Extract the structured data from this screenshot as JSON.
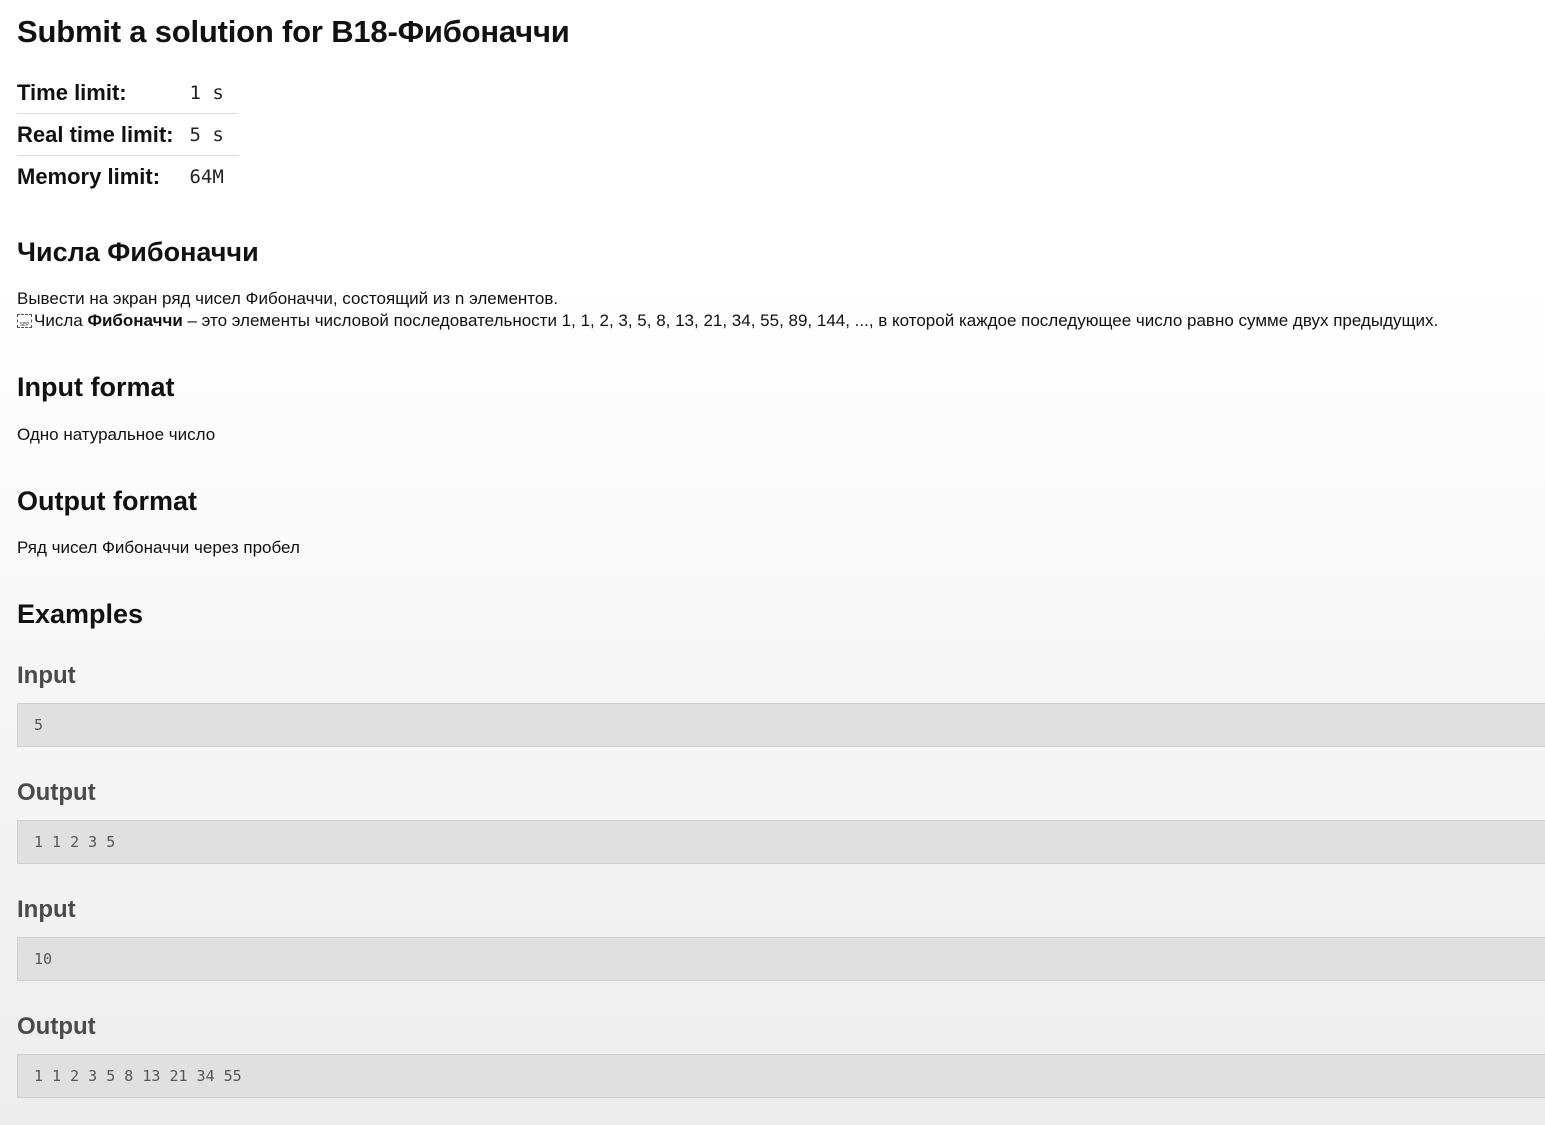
{
  "page": {
    "title": "Submit a solution for B18-Фибоначчи"
  },
  "limits": [
    {
      "label": "Time limit:",
      "value": "1 s"
    },
    {
      "label": "Real time limit:",
      "value": "5 s"
    },
    {
      "label": "Memory limit:",
      "value": "64M"
    }
  ],
  "statement": {
    "heading": "Числа Фибоначчи",
    "line1": "Вывести на экран ряд чисел Фибоначчи, состоящий из n элементов.",
    "line2_prefix": "Числа ",
    "line2_bold": "Фибоначчи",
    "line2_suffix": " – это элементы числовой последовательности 1, 1, 2, 3, 5, 8, 13, 21, 34, 55, 89, 144, ..., в которой каждое последующее число равно сумме двух предыдущих.",
    "icon": "sep-icon"
  },
  "input_format": {
    "heading": "Input format",
    "text": "Одно натуральное число"
  },
  "output_format": {
    "heading": "Output format",
    "text": "Ряд чисел Фибоначчи через пробел"
  },
  "examples": {
    "heading": "Examples",
    "items": [
      {
        "input_label": "Input",
        "input": "5",
        "output_label": "Output",
        "output": "1 1 2 3 5"
      },
      {
        "input_label": "Input",
        "input": "10",
        "output_label": "Output",
        "output": "1 1 2 3 5 8 13 21 34 55"
      }
    ]
  },
  "colors": {
    "code_background": "#e0e0e0",
    "subheading": "#4a4a4a",
    "text": "#111111"
  }
}
